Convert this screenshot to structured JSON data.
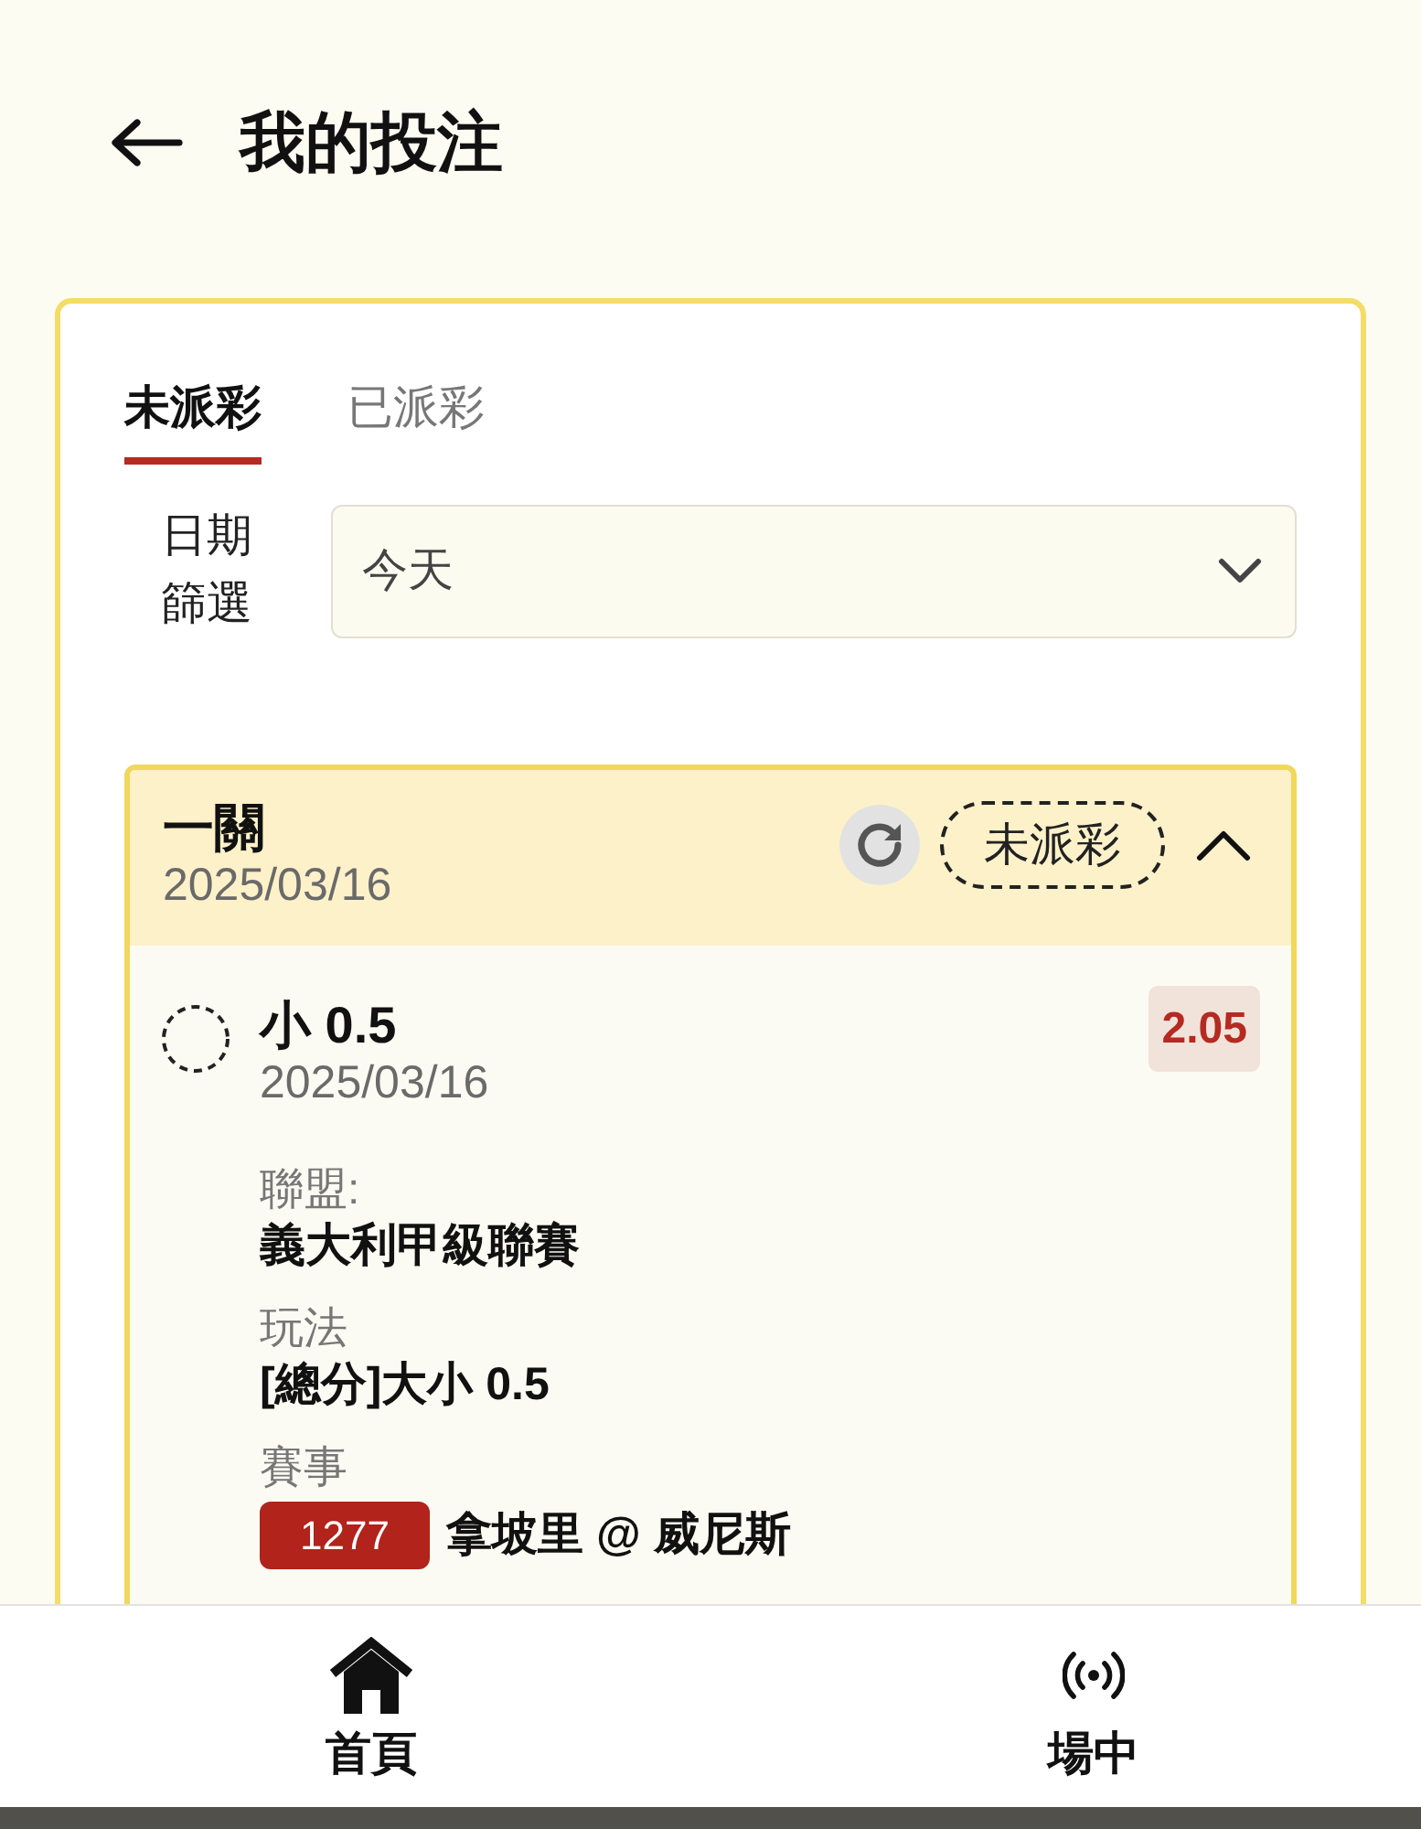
{
  "header": {
    "title": "我的投注"
  },
  "tabs": [
    {
      "label": "未派彩",
      "selected": true
    },
    {
      "label": "已派彩",
      "selected": false
    }
  ],
  "date_filter": {
    "label": "日期篩選",
    "value": "今天"
  },
  "bets": [
    {
      "title": "一關",
      "date": "2025/03/16",
      "status": "未派彩",
      "expanded": true,
      "selections": [
        {
          "name": "小 0.5",
          "date": "2025/03/16",
          "odds": "2.05",
          "fields": [
            {
              "kind": "text",
              "label": "聯盟:",
              "value": "義大利甲級聯賽"
            },
            {
              "kind": "text",
              "label": "玩法",
              "value": "[總分]大小 0.5"
            },
            {
              "kind": "match",
              "label": "賽事",
              "match_no": "1277",
              "value": "拿坡里 @ 威尼斯"
            }
          ]
        }
      ]
    }
  ],
  "nav": [
    {
      "kind": "home",
      "label": "首頁"
    },
    {
      "kind": "live",
      "label": "場中"
    }
  ]
}
